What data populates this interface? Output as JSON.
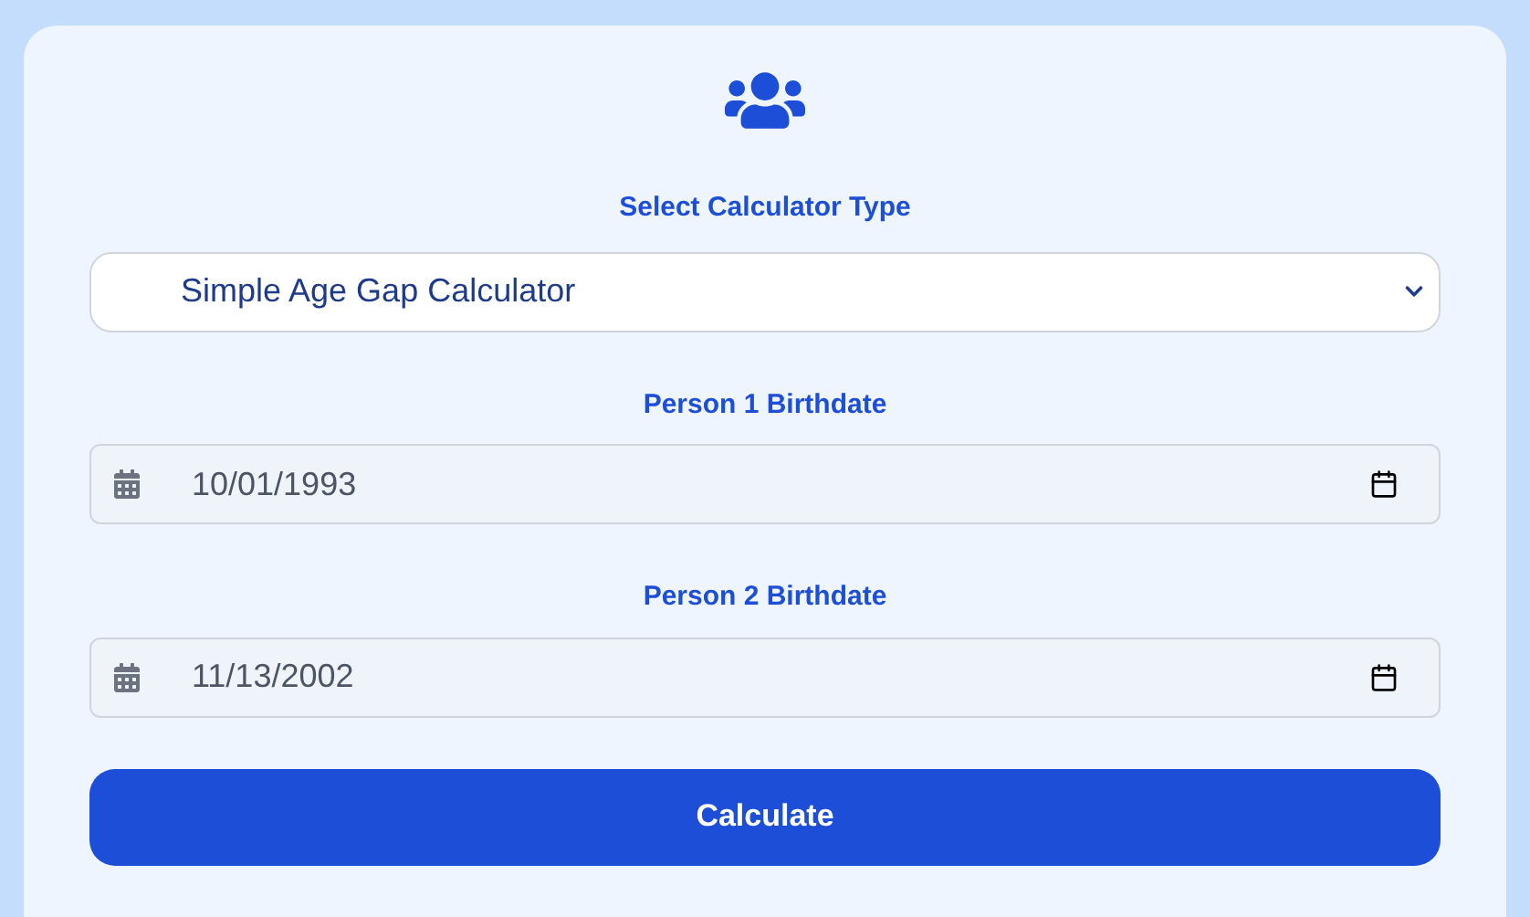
{
  "calculator_type": {
    "label": "Select Calculator Type",
    "value": "Simple Age Gap Calculator"
  },
  "fields": [
    {
      "label": "Person 1 Birthdate",
      "value": "10/01/1993"
    },
    {
      "label": "Person 2 Birthdate",
      "value": "11/13/2002"
    }
  ],
  "button": "Calculate"
}
